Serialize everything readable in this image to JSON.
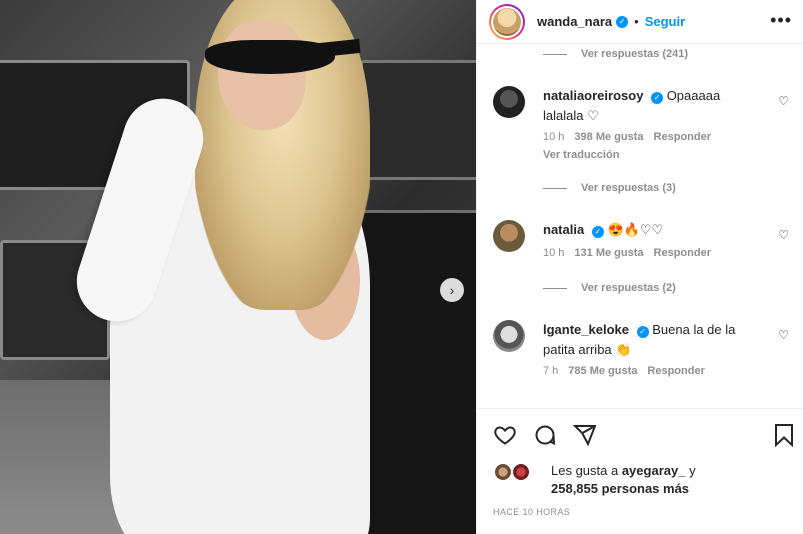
{
  "post": {
    "carousel_next_icon": "chevron-right-icon"
  },
  "header": {
    "username": "wanda_nara",
    "follow_label": "Seguir",
    "separator": "•",
    "more_icon": "more-horizontal-icon"
  },
  "comments": {
    "top_replies": "Ver respuestas (241)",
    "items": [
      {
        "username": "nataliaoreirosoy",
        "text": "Opaaaaa lalalala ♡",
        "time": "10 h",
        "likes": "398 Me gusta",
        "reply": "Responder",
        "translate": "Ver traducción",
        "replies": "Ver respuestas (3)"
      },
      {
        "username": "natalia",
        "text": "😍🔥♡♡",
        "time": "10 h",
        "likes": "131 Me gusta",
        "reply": "Responder",
        "replies": "Ver respuestas (2)"
      },
      {
        "username": "lgante_keloke",
        "text": "Buena la de la patita arriba 👏",
        "time": "7 h",
        "likes": "785 Me gusta",
        "reply": "Responder"
      }
    ]
  },
  "likes": {
    "prefix": "Les gusta a ",
    "user": "ayegaray_",
    "mid": " y",
    "count": "258,855 personas más"
  },
  "timestamp": "HACE 10 HORAS",
  "colors": {
    "accent": "#0095f6",
    "muted": "#8e8e8e",
    "text": "#262626"
  }
}
